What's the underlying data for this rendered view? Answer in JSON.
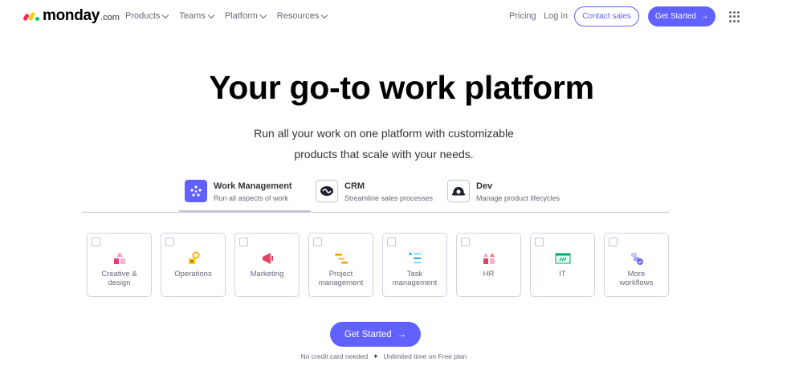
{
  "nav": {
    "logo_text": "monday",
    "logo_suffix": ".com",
    "menu": [
      "Products",
      "Teams",
      "Platform",
      "Resources"
    ],
    "pricing": "Pricing",
    "login": "Log in",
    "contact": "Contact sales",
    "get_started": "Get Started"
  },
  "hero": {
    "title": "Your go-to work platform",
    "subtitle_line1": "Run all your work on one platform with customizable",
    "subtitle_line2": "products that scale with your needs."
  },
  "products": [
    {
      "title": "Work Management",
      "desc": "Run all aspects of work",
      "icon": "work-management-icon"
    },
    {
      "title": "CRM",
      "desc": "Streamline sales processes",
      "icon": "crm-icon"
    },
    {
      "title": "Dev",
      "desc": "Manage product lifecycles",
      "icon": "dev-icon"
    }
  ],
  "workflows": [
    {
      "line1": "Creative &",
      "line2": "design",
      "icon": "creative-design-icon"
    },
    {
      "line1": "Operations",
      "line2": "",
      "icon": "operations-icon"
    },
    {
      "line1": "Marketing",
      "line2": "",
      "icon": "marketing-icon"
    },
    {
      "line1": "Project",
      "line2": "management",
      "icon": "project-management-icon"
    },
    {
      "line1": "Task",
      "line2": "management",
      "icon": "task-management-icon"
    },
    {
      "line1": "HR",
      "line2": "",
      "icon": "hr-icon"
    },
    {
      "line1": "IT",
      "line2": "",
      "icon": "it-icon"
    },
    {
      "line1": "More",
      "line2": "workflows",
      "icon": "more-workflows-icon"
    }
  ],
  "cta": {
    "label": "Get Started",
    "note_left": "No credit card needed",
    "note_sep": "✦",
    "note_right": "Unlimited time on Free plan"
  },
  "colors": {
    "brand": "#6161ff",
    "text": "#323338",
    "muted": "#676879",
    "border": "#d0d4e4"
  }
}
